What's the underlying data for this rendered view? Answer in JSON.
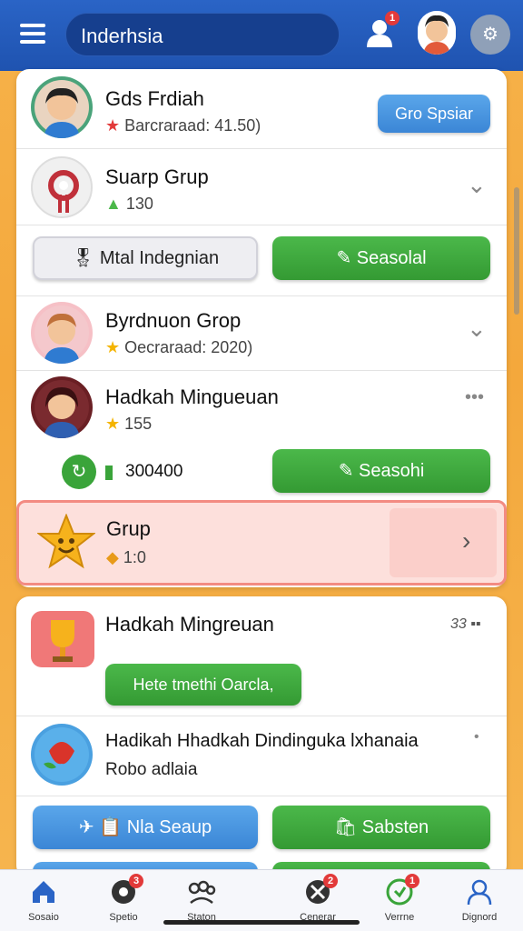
{
  "header": {
    "search_text": "Inderhsia",
    "user_badge": "1",
    "icons": [
      "menu-icon",
      "user-icon",
      "settings-icon"
    ]
  },
  "card1": {
    "rows": [
      {
        "title": "Gds Frdiah",
        "sub": "Barcraraad: 41.50)",
        "button": "Gro Spsiar"
      },
      {
        "title": "Suarp Grup",
        "sub": "130"
      }
    ],
    "buttons": {
      "left": "Mtal Indegnian",
      "right": "Seasolal"
    },
    "rows2": [
      {
        "title": "Byrdnuon Grop",
        "sub": "Oecraraad: 2020)"
      },
      {
        "title": "Hadkah Mingueuan",
        "sub": "155"
      }
    ],
    "stat": {
      "value": "300400",
      "button": "Seasohi"
    },
    "highlight": {
      "title": "Grup",
      "sub": "1:0"
    }
  },
  "card2": {
    "row1": {
      "title": "Hadkah Mingreuan",
      "meta": "33",
      "button": "Hete tmethi Oarcla,"
    },
    "row2": {
      "title": "Hadikah Hhadkah Dindinguka lxhanaia",
      "sub": "Robo adlaia"
    },
    "buttons": {
      "left": "Nla Seaup",
      "right": "Sabsten"
    }
  },
  "nav": {
    "items": [
      {
        "label": "Sosaio",
        "icon": "home-icon"
      },
      {
        "label": "Spetio",
        "icon": "sports-icon",
        "badge": "3"
      },
      {
        "label": "Staton",
        "icon": "people-icon"
      },
      {
        "label": "Cenerar",
        "icon": "tools-icon",
        "badge": "2"
      },
      {
        "label": "Verrne",
        "icon": "shield-icon",
        "badge": "1"
      },
      {
        "label": "Dignord",
        "icon": "profile-icon"
      }
    ]
  },
  "colors": {
    "topbar": "#2a64c6",
    "green": "#3aa43a",
    "blue": "#4a96e0",
    "highlight": "#fde0dc"
  }
}
